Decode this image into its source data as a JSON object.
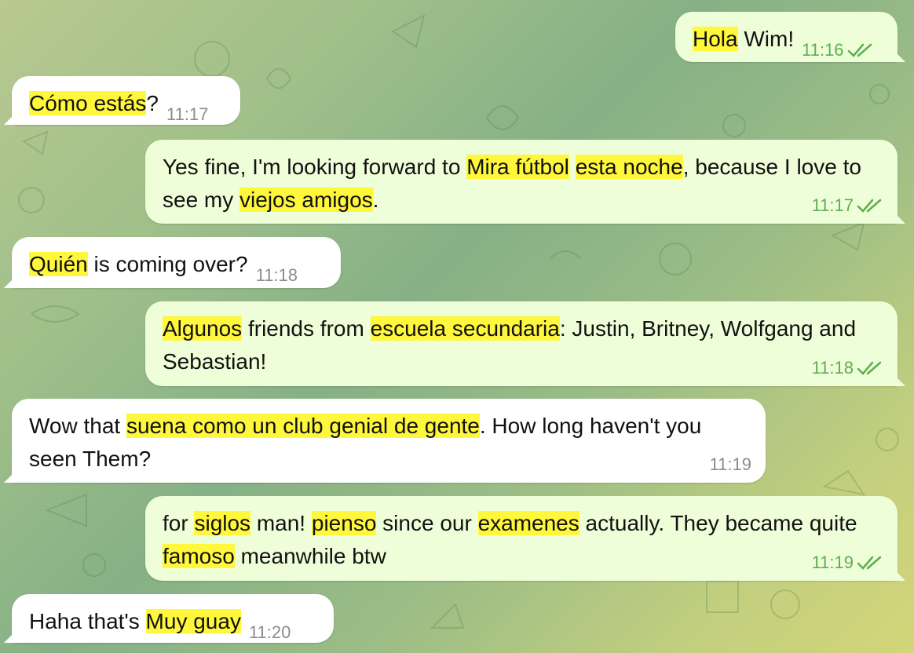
{
  "colors": {
    "incoming_bubble": "#ffffff",
    "outgoing_bubble": "#eefed9",
    "highlight": "#fff73b",
    "outgoing_meta": "#5fae4f",
    "incoming_meta": "#8c8c8c"
  },
  "messages": [
    {
      "direction": "out",
      "segments": [
        {
          "text": "Hola",
          "hl": true
        },
        {
          "text": " Wim!"
        }
      ],
      "time": "11:16",
      "read": true
    },
    {
      "direction": "in",
      "segments": [
        {
          "text": "Cómo estás",
          "hl": true
        },
        {
          "text": "?"
        }
      ],
      "time": "11:17"
    },
    {
      "direction": "out",
      "segments": [
        {
          "text": "Yes fine, I'm looking forward to "
        },
        {
          "text": "Mira fútbol",
          "hl": true
        },
        {
          "text": " "
        },
        {
          "text": "esta noche",
          "hl": true
        },
        {
          "text": ", because I love to see my "
        },
        {
          "text": "viejos amigos",
          "hl": true
        },
        {
          "text": "."
        }
      ],
      "time": "11:17",
      "read": true
    },
    {
      "direction": "in",
      "segments": [
        {
          "text": "Quién",
          "hl": true
        },
        {
          "text": " is coming over?"
        }
      ],
      "time": "11:18"
    },
    {
      "direction": "out",
      "segments": [
        {
          "text": "Algunos",
          "hl": true
        },
        {
          "text": " friends from "
        },
        {
          "text": "escuela secundaria",
          "hl": true
        },
        {
          "text": ": Justin, Britney, Wolfgang and Sebastian!"
        }
      ],
      "time": "11:18",
      "read": true
    },
    {
      "direction": "in",
      "segments": [
        {
          "text": "Wow that "
        },
        {
          "text": "suena como un club genial de gente",
          "hl": true
        },
        {
          "text": ". How long haven't you seen Them?"
        }
      ],
      "time": "11:19"
    },
    {
      "direction": "out",
      "segments": [
        {
          "text": "for "
        },
        {
          "text": "siglos",
          "hl": true
        },
        {
          "text": " man! "
        },
        {
          "text": "pienso",
          "hl": true
        },
        {
          "text": " since our "
        },
        {
          "text": "examenes",
          "hl": true
        },
        {
          "text": " actually. They became quite "
        },
        {
          "text": "famoso",
          "hl": true
        },
        {
          "text": " meanwhile btw"
        }
      ],
      "time": "11:19",
      "read": true
    },
    {
      "direction": "in",
      "segments": [
        {
          "text": "Haha that's "
        },
        {
          "text": "Muy guay",
          "hl": true
        }
      ],
      "time": "11:20"
    }
  ]
}
